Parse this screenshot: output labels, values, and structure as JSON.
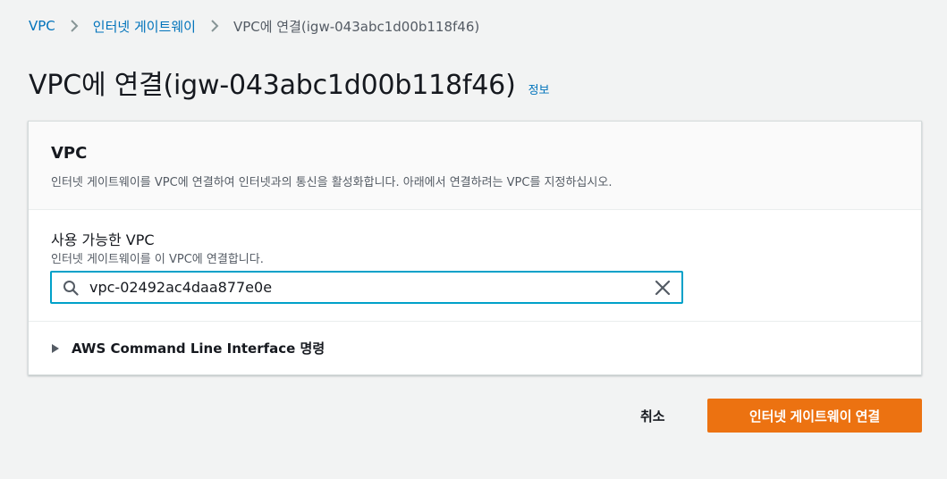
{
  "breadcrumb": {
    "items": [
      {
        "label": "VPC"
      },
      {
        "label": "인터넷 게이트웨이"
      },
      {
        "label": "VPC에 연결(igw-043abc1d00b118f46)"
      }
    ]
  },
  "page": {
    "title": "VPC에 연결(igw-043abc1d00b118f46)",
    "info_link": "정보"
  },
  "panel": {
    "title": "VPC",
    "description": "인터넷 게이트웨이를 VPC에 연결하여 인터넷과의 통신을 활성화합니다. 아래에서 연결하려는 VPC를 지정하십시오.",
    "field": {
      "label": "사용 가능한 VPC",
      "description": "인터넷 게이트웨이를 이 VPC에 연결합니다.",
      "value": "vpc-02492ac4daa877e0e",
      "icon": "search-icon",
      "clear_icon": "close-icon"
    },
    "cli": {
      "label": "AWS Command Line Interface 명령",
      "expanded": false
    }
  },
  "actions": {
    "cancel_label": "취소",
    "submit_label": "인터넷 게이트웨이 연결"
  },
  "colors": {
    "accent": "#ec7211",
    "link": "#0073bb",
    "focus": "#00a1c9",
    "background": "#f2f3f3"
  }
}
